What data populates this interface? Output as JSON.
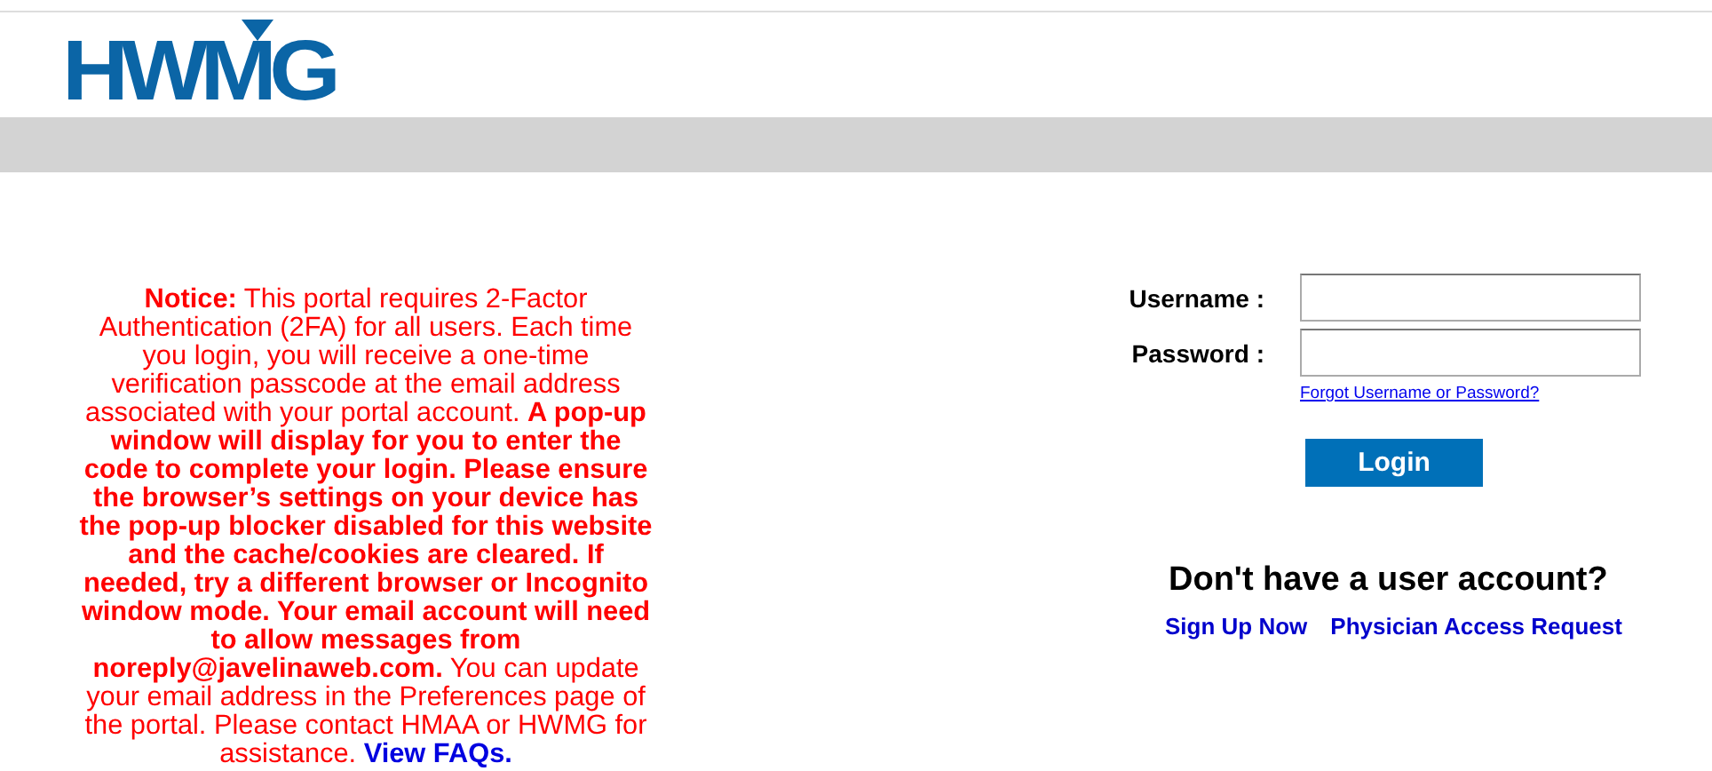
{
  "header": {
    "logo": "HWMG"
  },
  "notice": {
    "text": "**Notice:** This portal requires 2-Factor Authentication (2FA) for all users. Each time you login, you will receive a one-time verification passcode at the email address associated with your portal account. **A pop-up window will display for you to enter the code to complete your login. Please ensure the browser’s settings on your device has the pop-up blocker disabled for this website and the cache/cookies are cleared. If needed, try a different browser or Incognito window mode. Your email account will need to allow messages from noreply@javelinaweb.com.** You can update your email address in the Preferences page of the portal. Please contact HMAA or HWMG for assistance.",
    "link": "View FAQs."
  },
  "login": {
    "fields": [
      {
        "label": "Username :"
      },
      {
        "label": "Password :"
      }
    ],
    "forgot_link": "Forgot Username or Password?",
    "button": "Login"
  },
  "signup": {
    "heading": "Don't have a user account?",
    "links": [
      "Sign Up Now",
      "Physician Access Request"
    ]
  }
}
